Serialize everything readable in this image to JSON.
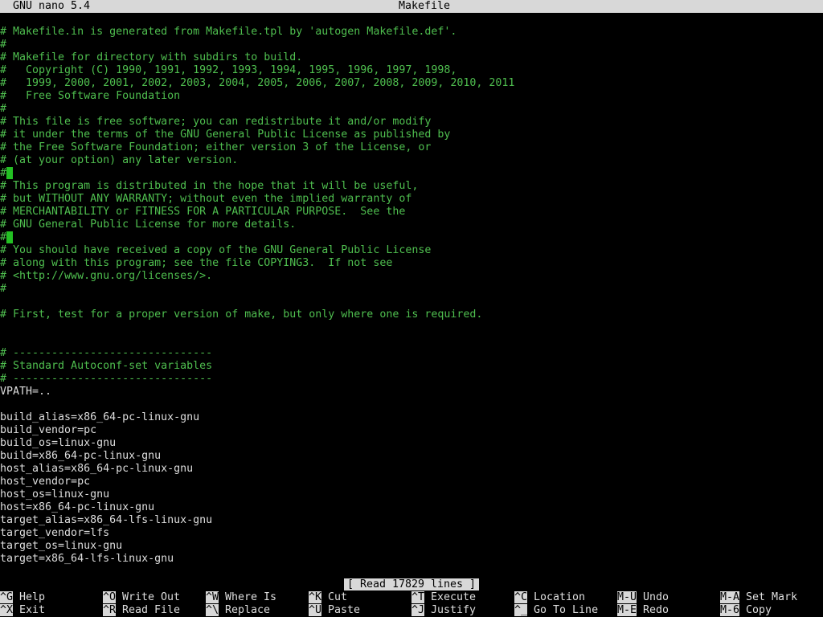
{
  "titlebar": {
    "app": "GNU nano 5.4",
    "file": "Makefile"
  },
  "editor": {
    "lines": [
      {
        "text": "# Makefile.in is generated from Makefile.tpl by 'autogen Makefile.def'.",
        "type": "comment"
      },
      {
        "text": "#",
        "type": "comment"
      },
      {
        "text": "# Makefile for directory with subdirs to build.",
        "type": "comment"
      },
      {
        "text": "#   Copyright (C) 1990, 1991, 1992, 1993, 1994, 1995, 1996, 1997, 1998,",
        "type": "comment"
      },
      {
        "text": "#   1999, 2000, 2001, 2002, 2003, 2004, 2005, 2006, 2007, 2008, 2009, 2010, 2011",
        "type": "comment"
      },
      {
        "text": "#   Free Software Foundation",
        "type": "comment"
      },
      {
        "text": "#",
        "type": "comment"
      },
      {
        "text": "# This file is free software; you can redistribute it and/or modify",
        "type": "comment"
      },
      {
        "text": "# it under the terms of the GNU General Public License as published by",
        "type": "comment"
      },
      {
        "text": "# the Free Software Foundation; either version 3 of the License, or",
        "type": "comment"
      },
      {
        "text": "# (at your option) any later version.",
        "type": "comment"
      },
      {
        "text": "#",
        "type": "comment-block"
      },
      {
        "text": "# This program is distributed in the hope that it will be useful,",
        "type": "comment"
      },
      {
        "text": "# but WITHOUT ANY WARRANTY; without even the implied warranty of",
        "type": "comment"
      },
      {
        "text": "# MERCHANTABILITY or FITNESS FOR A PARTICULAR PURPOSE.  See the",
        "type": "comment"
      },
      {
        "text": "# GNU General Public License for more details.",
        "type": "comment"
      },
      {
        "text": "#",
        "type": "comment-block"
      },
      {
        "text": "# You should have received a copy of the GNU General Public License",
        "type": "comment"
      },
      {
        "text": "# along with this program; see the file COPYING3.  If not see",
        "type": "comment"
      },
      {
        "text": "# <http://www.gnu.org/licenses/>.",
        "type": "comment"
      },
      {
        "text": "#",
        "type": "comment"
      },
      {
        "text": "",
        "type": "code"
      },
      {
        "text": "# First, test for a proper version of make, but only where one is required.",
        "type": "comment"
      },
      {
        "text": "",
        "type": "code"
      },
      {
        "text": "",
        "type": "code"
      },
      {
        "text": "# -------------------------------",
        "type": "comment"
      },
      {
        "text": "# Standard Autoconf-set variables",
        "type": "comment"
      },
      {
        "text": "# -------------------------------",
        "type": "comment"
      },
      {
        "text": "VPATH=..",
        "type": "code"
      },
      {
        "text": "",
        "type": "code"
      },
      {
        "text": "build_alias=x86_64-pc-linux-gnu",
        "type": "code"
      },
      {
        "text": "build_vendor=pc",
        "type": "code"
      },
      {
        "text": "build_os=linux-gnu",
        "type": "code"
      },
      {
        "text": "build=x86_64-pc-linux-gnu",
        "type": "code"
      },
      {
        "text": "host_alias=x86_64-pc-linux-gnu",
        "type": "code"
      },
      {
        "text": "host_vendor=pc",
        "type": "code"
      },
      {
        "text": "host_os=linux-gnu",
        "type": "code"
      },
      {
        "text": "host=x86_64-pc-linux-gnu",
        "type": "code"
      },
      {
        "text": "target_alias=x86_64-lfs-linux-gnu",
        "type": "code"
      },
      {
        "text": "target_vendor=lfs",
        "type": "code"
      },
      {
        "text": "target_os=linux-gnu",
        "type": "code"
      },
      {
        "text": "target=x86_64-lfs-linux-gnu",
        "type": "code"
      }
    ]
  },
  "status": {
    "message": "[ Read 17829 lines ]"
  },
  "shortcuts": [
    {
      "key": "^G",
      "label": "Help"
    },
    {
      "key": "^X",
      "label": "Exit"
    },
    {
      "key": "^O",
      "label": "Write Out"
    },
    {
      "key": "^R",
      "label": "Read File"
    },
    {
      "key": "^W",
      "label": "Where Is"
    },
    {
      "key": "^\\",
      "label": "Replace"
    },
    {
      "key": "^K",
      "label": "Cut"
    },
    {
      "key": "^U",
      "label": "Paste"
    },
    {
      "key": "^T",
      "label": "Execute"
    },
    {
      "key": "^J",
      "label": "Justify"
    },
    {
      "key": "^C",
      "label": "Location"
    },
    {
      "key": "^_",
      "label": "Go To Line"
    },
    {
      "key": "M-U",
      "label": "Undo"
    },
    {
      "key": "M-E",
      "label": "Redo"
    },
    {
      "key": "M-A",
      "label": "Set Mark"
    },
    {
      "key": "M-6",
      "label": "Copy"
    }
  ],
  "colors": {
    "comment": "#4fbf4f",
    "code": "#dedede",
    "bar": "#d8d8d8",
    "background": "#000000"
  }
}
